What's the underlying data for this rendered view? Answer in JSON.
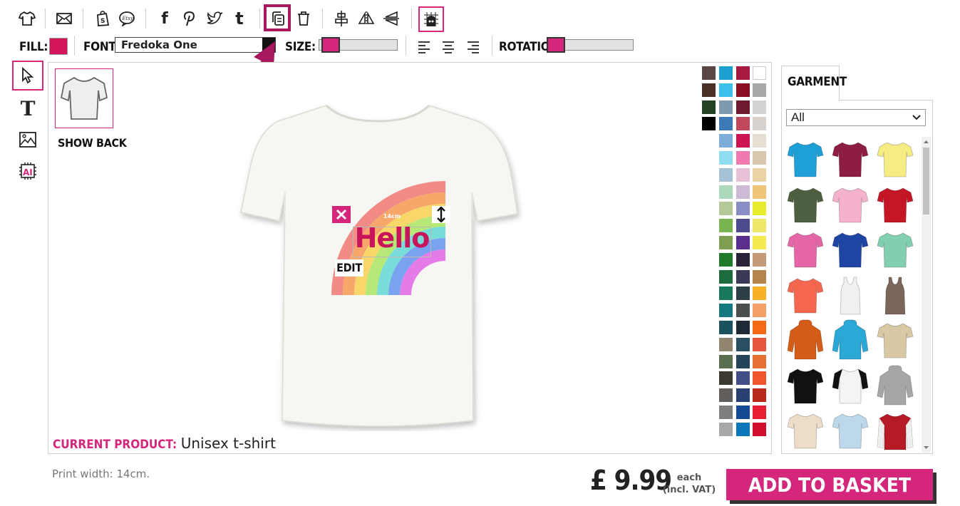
{
  "toolbar": {
    "icons": [
      "tshirt-icon",
      "envelope-icon",
      "shopify-icon",
      "etsy-icon",
      "facebook-icon",
      "pinterest-icon",
      "twitter-icon",
      "tumblr-icon",
      "copy-icon",
      "trash-icon",
      "align-center-icon",
      "flip-horizontal-icon",
      "flip-vertical-icon",
      "grid-icon"
    ],
    "highlighted": "copy-icon",
    "fill_label": "FILL:",
    "fill_color": "#d4145a",
    "font_label": "FONT:",
    "font_value": "Fredoka One",
    "size_label": "SIZE:",
    "size_level": 0.05,
    "rotation_label": "ROTATION:",
    "rotation_level": 0.1,
    "text_align_icons": [
      "align-left-icon",
      "align-center-text-icon",
      "align-right-icon"
    ]
  },
  "left_tools": [
    "pointer-icon",
    "text-tool-icon",
    "image-tool-icon",
    "ai-tool-icon"
  ],
  "canvas": {
    "show_back_label": "SHOW BACK",
    "design_text": "Hello",
    "design_size_label": "14cm",
    "edit_label": "EDIT",
    "current_product_label": "CURRENT PRODUCT:",
    "current_product_value": "Unisex t-shirt"
  },
  "palette_colors": [
    "#5a4743",
    "#1e9fd2",
    "#a7193f",
    "#ffffff",
    "#4a3026",
    "#3cbfea",
    "#8b0f24",
    "#a8a8a8",
    "#224226",
    "#7f9aae",
    "#6d1a2c",
    "#d3d3d3",
    "#000000",
    "#3d7bb8",
    "#c04a5c",
    "#d8d2ce",
    null,
    "#7fadd9",
    "#cc1455",
    "#e6e0d4",
    null,
    "#90dcf0",
    "#f07ab0",
    "#d9c8ae",
    null,
    "#a6c2d6",
    "#e9c1d6",
    "#ebd3a6",
    null,
    "#acd8bc",
    "#cdbad6",
    "#efc678",
    null,
    "#b4c898",
    "#8a8ec6",
    "#e7ed2c",
    null,
    "#78b450",
    "#4e4a8e",
    "#ede86a",
    null,
    "#7e9e52",
    "#5a2e8c",
    "#f6ea50",
    null,
    "#1f7a2c",
    "#2a2238",
    "#c49a78",
    null,
    "#1e6c3e",
    "#3a3a56",
    "#b5844c",
    null,
    "#18785c",
    "#2e3e46",
    "#f8b028",
    null,
    "#147880",
    "#4a5050",
    "#f6a068",
    null,
    "#1a5260",
    "#1e2a36",
    "#f66a16",
    null,
    "#938670",
    "#2a4e62",
    "#e6563e",
    null,
    "#5a6e50",
    "#24445a",
    "#e67034",
    null,
    "#3c3a30",
    "#424e86",
    "#f0562e",
    null,
    "#625e5c",
    "#284072",
    "#b82a1c",
    null,
    "#7e7e7e",
    "#144a94",
    "#e62032",
    null,
    "#a8a8a8",
    "#0a78b8",
    "#d0102e"
  ],
  "garment": {
    "tab_label": "GARMENT",
    "filter_value": "All",
    "items": [
      {
        "name": "tee-cyan",
        "color": "#1ea0d6",
        "kind": "tee"
      },
      {
        "name": "tee-maroon",
        "color": "#8e1d44",
        "kind": "tee"
      },
      {
        "name": "tee-yellow",
        "color": "#f6ec84",
        "kind": "tee"
      },
      {
        "name": "tee-olive",
        "color": "#4e5e40",
        "kind": "tee"
      },
      {
        "name": "tee-pink",
        "color": "#f4b2cc",
        "kind": "tee"
      },
      {
        "name": "tee-red",
        "color": "#c41624",
        "kind": "tee"
      },
      {
        "name": "tee-magenta",
        "color": "#e466a6",
        "kind": "tee"
      },
      {
        "name": "tee-royal",
        "color": "#1e44a4",
        "kind": "tee"
      },
      {
        "name": "tee-mint",
        "color": "#82cfaf",
        "kind": "tee"
      },
      {
        "name": "tee-coral",
        "color": "#f5664e",
        "kind": "tee"
      },
      {
        "name": "tank-white",
        "color": "#f0f0f0",
        "kind": "tank"
      },
      {
        "name": "tank-mocha",
        "color": "#7a665a",
        "kind": "tank"
      },
      {
        "name": "hoodie-orange",
        "color": "#d55c16",
        "kind": "hoodie"
      },
      {
        "name": "hoodie-cyan",
        "color": "#2aa8d6",
        "kind": "hoodie"
      },
      {
        "name": "tee-tiedye",
        "color": "#d8c8a4",
        "kind": "tee"
      },
      {
        "name": "tee-black",
        "color": "#111111",
        "kind": "tee"
      },
      {
        "name": "raglan-black-white",
        "color": "#f4f4f4",
        "kind": "raglan"
      },
      {
        "name": "hoodie-grey",
        "color": "#a6a6a6",
        "kind": "hoodie"
      },
      {
        "name": "tee-natural",
        "color": "#ecdcc8",
        "kind": "tee"
      },
      {
        "name": "tee-skyblue",
        "color": "#bcd8ea",
        "kind": "tee"
      },
      {
        "name": "varsity-red",
        "color": "#b61a26",
        "kind": "varsity"
      }
    ]
  },
  "footer": {
    "print_width": "Print width: 14cm.",
    "price": "£ 9.99",
    "each_line1": "each",
    "each_line2": "(incl. VAT)",
    "add_to_basket": "ADD TO BASKET"
  },
  "colors": {
    "accent": "#d4267a",
    "accent_dark": "#a8185e"
  }
}
